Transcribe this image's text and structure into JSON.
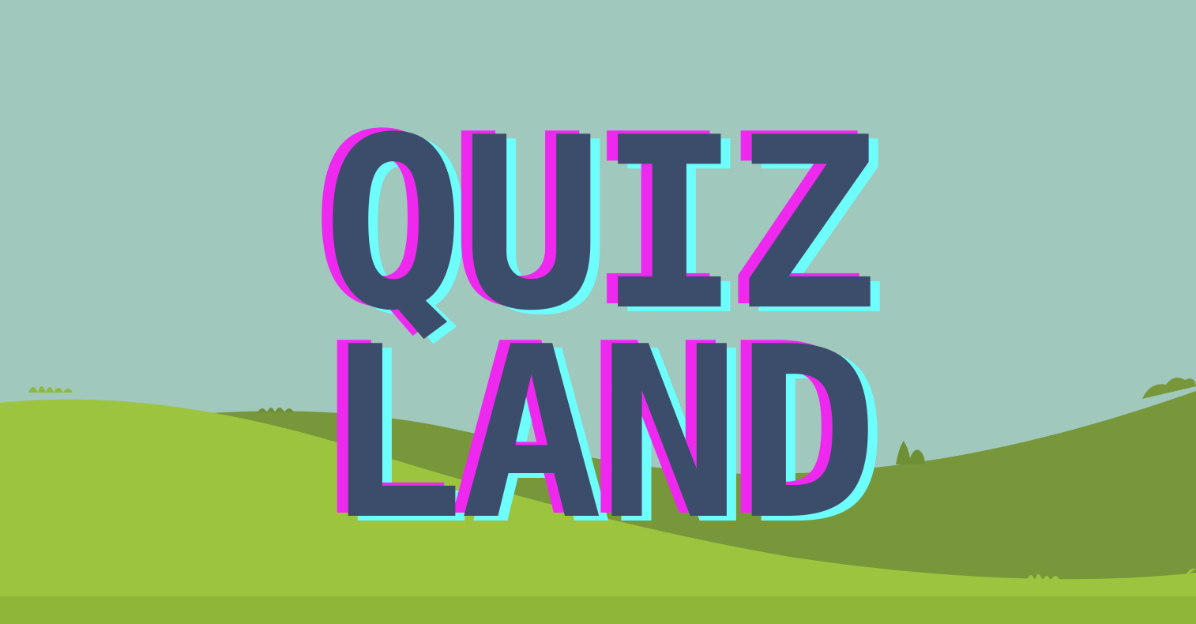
{
  "title": {
    "line1": "QUIZ",
    "line2": "LAND"
  },
  "colors": {
    "sky": "#a0c8bd",
    "hill_far": "#77973a",
    "hill_near": "#9dc43e",
    "letter_fill": "#3b4d6b",
    "glitch_magenta": "#ee28ee",
    "glitch_cyan": "#6dfdfb"
  }
}
